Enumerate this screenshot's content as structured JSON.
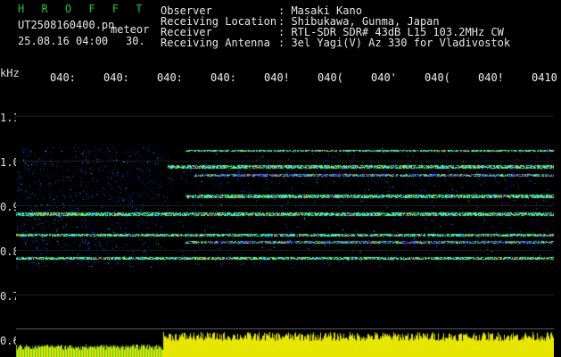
{
  "brand": "H R O F F T",
  "file_name": "UT2508160400.pn",
  "meteor_label": "meteor",
  "timestamp": "25.08.16 04:00",
  "count": "30.",
  "info": {
    "observer_label": "Observer",
    "observer_value": ": Masaki Kano",
    "location_label": "Receiving Location",
    "location_value": ": Shibukawa, Gunma, Japan",
    "receiver_label": "Receiver",
    "receiver_value": ": RTL-SDR SDR# 43dB L15 103.2MHz CW",
    "antenna_label": "Receiving Antenna",
    "antenna_value": ": 3el Yagi(V) Az 330 for Vladivostok"
  },
  "time_axis": {
    "labels": [
      "040:",
      "040:",
      "040:",
      "040:",
      "040!",
      "040(",
      "040'",
      "040(",
      "040!",
      "0410"
    ]
  },
  "freq_axis": {
    "unit": "kHz",
    "labels": [
      "1.1",
      "1.0",
      "0.9",
      "0.8",
      "0.7",
      "0.6"
    ]
  },
  "colors": {
    "background": "#000000",
    "brand": "#21c43a",
    "header_text": "#e8e8e8",
    "meter": "#e6e600",
    "noise_dark": "#0a1a8c",
    "noise_mid": "#2a5fff",
    "echo_cyan": "#35e6e6",
    "echo_green": "#6cff4a",
    "echo_red": "#ff3b2f"
  }
}
